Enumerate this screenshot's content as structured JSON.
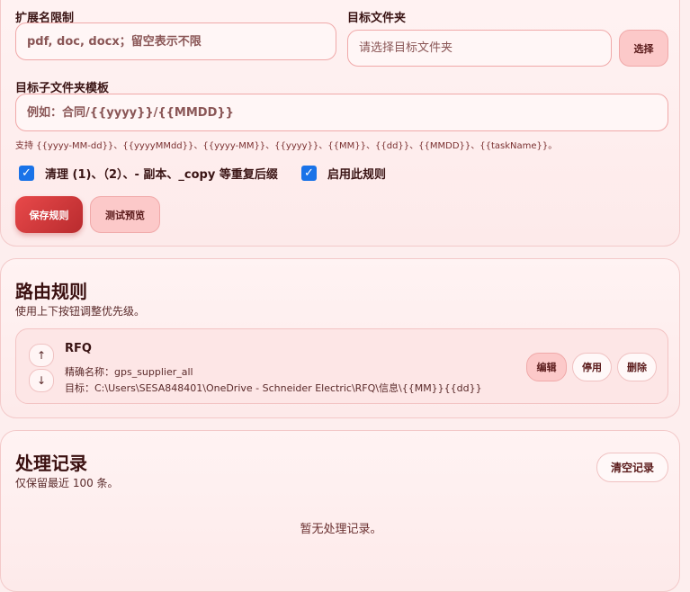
{
  "form": {
    "ext_label": "扩展名限制",
    "ext_placeholder": "pdf, doc, docx；留空表示不限",
    "dest_label": "目标文件夹",
    "dest_placeholder": "请选择目标文件夹",
    "choose_label": "选择",
    "subfolder_label": "目标子文件夹模板",
    "subfolder_placeholder": "例如：合同/{{yyyy}}/{{MMDD}}",
    "hint": "支持 {{yyyy-MM-dd}}、{{yyyyMMdd}}、{{yyyy-MM}}、{{yyyy}}、{{MM}}、{{dd}}、{{MMDD}}、{{taskName}}。",
    "cleanup_label": "清理 (1)、（2）、- 副本、_copy 等重复后缀",
    "enable_label": "启用此规则",
    "save_label": "保存规则",
    "test_label": "测试预览"
  },
  "routes": {
    "title": "路由规则",
    "subtitle": "使用上下按钮调整优先级。",
    "up_glyph": "↑",
    "down_glyph": "↓",
    "items": [
      {
        "name": "RFQ",
        "match": "精确名称：gps_supplier_all",
        "target": "目标：C:\\Users\\SESA848401\\OneDrive - Schneider Electric\\RFQ\\信息\\{{MM}}{{dd}}",
        "edit_label": "编辑",
        "disable_label": "停用",
        "delete_label": "删除"
      }
    ]
  },
  "log": {
    "title": "处理记录",
    "subtitle": "仅保留最近 100 条。",
    "clear_label": "清空记录",
    "empty": "暂无处理记录。"
  },
  "colors": {
    "accent": "#e8494a",
    "checkbox": "#1a73e8",
    "background": "#fdeeee"
  }
}
